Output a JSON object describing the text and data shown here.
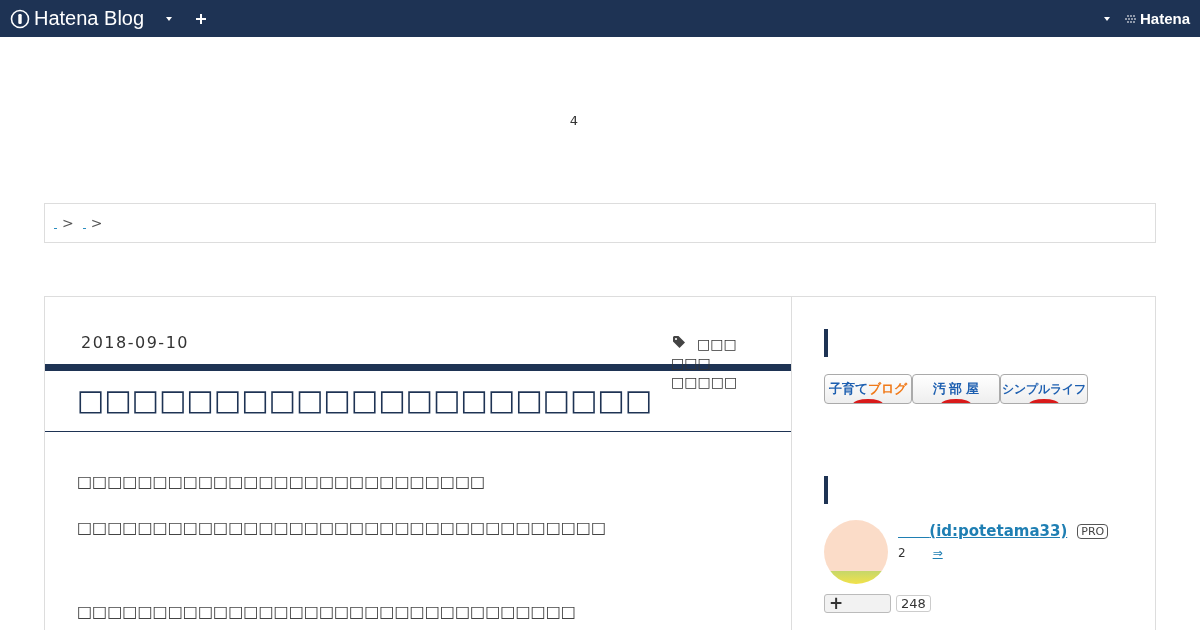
{
  "header": {
    "logo": "Hatena Blog",
    "brand": "Hatena"
  },
  "ad_slot": {
    "text": "4"
  },
  "breadcrumbs": [
    {
      "separator": ">"
    },
    {
      "separator": ">"
    }
  ],
  "entry": {
    "date": "2018-09-10",
    "categories": [
      "□□□",
      "□□□",
      "□□□□□"
    ],
    "title": "□□□□□□□□□□□□□□□□□□□□□",
    "paragraphs": [
      "□□□□□□□□□□□□□□□□□□□□□□□□□□□",
      "□□□□□□□□□□□□□□□□□□□□□□□□□□□□□□□□□□□",
      "□□□□□□□□□□□□□□□□□□□□□□□□□□□□□□□□□"
    ]
  },
  "sidebar": {
    "banners": [
      {
        "parts": [
          "子育て",
          "ブログ"
        ]
      },
      {
        "parts": [
          "汚 部 屋"
        ]
      },
      {
        "parts": [
          "シンプルライフ"
        ]
      }
    ],
    "profile": {
      "id": "(id:potetama33)",
      "badge": "PRO",
      "count_text": "2",
      "more_link": "⇒",
      "follow_icon": "+",
      "followers": "248"
    }
  }
}
